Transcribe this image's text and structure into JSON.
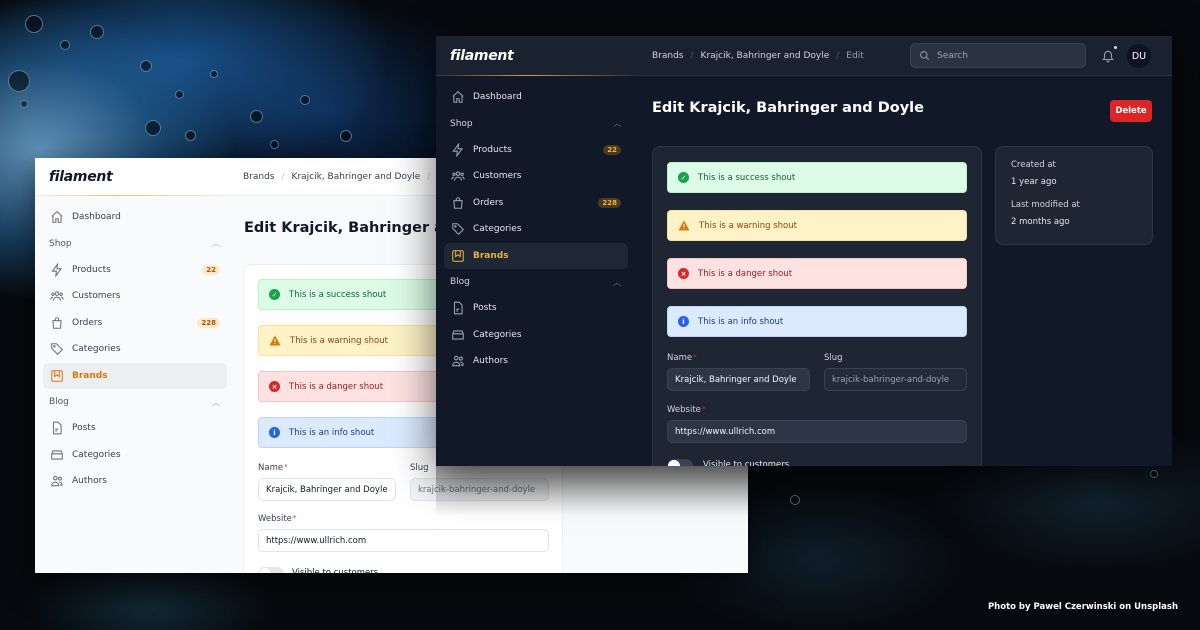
{
  "background": {
    "credit": "Photo by Pawel Czerwinski on Unsplash"
  },
  "app": {
    "logo": "filament",
    "breadcrumbs": [
      "Brands",
      "Krajcik, Bahringer and Doyle",
      "Edit"
    ],
    "search_placeholder": "Search",
    "avatar_initials": "DU",
    "page_title": "Edit Krajcik, Bahringer and Doyle",
    "delete_label": "Delete"
  },
  "sidebar": {
    "dashboard": "Dashboard",
    "groups": [
      {
        "label": "Shop",
        "items": [
          {
            "label": "Products",
            "icon": "bolt-icon",
            "badge": "22"
          },
          {
            "label": "Customers",
            "icon": "users-group-icon",
            "badge": ""
          },
          {
            "label": "Orders",
            "icon": "shopping-bag-icon",
            "badge": "228"
          },
          {
            "label": "Categories",
            "icon": "tag-icon",
            "badge": ""
          },
          {
            "label": "Brands",
            "icon": "bookmark-square-icon",
            "badge": "",
            "active": true
          }
        ]
      },
      {
        "label": "Blog",
        "items": [
          {
            "label": "Posts",
            "icon": "document-text-icon"
          },
          {
            "label": "Categories",
            "icon": "inbox-stack-icon"
          },
          {
            "label": "Authors",
            "icon": "users-icon"
          }
        ]
      }
    ]
  },
  "shouts": {
    "success": "This is a success shout",
    "warning": "This is a warning shout",
    "danger": "This is a danger shout",
    "info": "This is an info shout"
  },
  "form": {
    "name_label": "Name",
    "name_value": "Krajcik, Bahringer and Doyle",
    "slug_label": "Slug",
    "slug_value": "krajcik-bahringer-and-doyle",
    "website_label": "Website",
    "website_value": "https://www.ullrich.com",
    "visible_label": "Visible to customers",
    "visible_on": false,
    "required_mark": "*"
  },
  "meta": {
    "created_label": "Created at",
    "created_value": "1 year ago",
    "modified_label": "Last modified at",
    "modified_value": "2 months ago"
  },
  "colors": {
    "primary": "#d97706",
    "primary_dark_theme": "#e8b33f",
    "danger": "#dc2626",
    "success": "#16a34a",
    "info": "#2563eb"
  }
}
